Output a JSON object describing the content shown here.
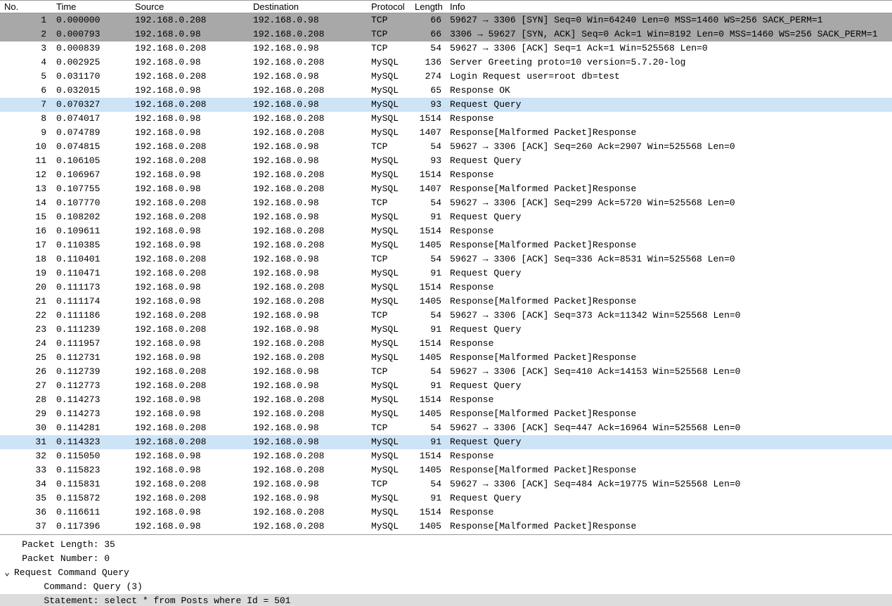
{
  "columns": {
    "no": "No.",
    "time": "Time",
    "src": "Source",
    "dst": "Destination",
    "proto": "Protocol",
    "len": "Length",
    "info": "Info"
  },
  "packets": [
    {
      "no": 1,
      "time": "0.000000",
      "src": "192.168.0.208",
      "dst": "192.168.0.98",
      "proto": "TCP",
      "len": 66,
      "info": "59627 → 3306 [SYN] Seq=0 Win=64240 Len=0 MSS=1460 WS=256 SACK_PERM=1",
      "hl": "sel-dark"
    },
    {
      "no": 2,
      "time": "0.000793",
      "src": "192.168.0.98",
      "dst": "192.168.0.208",
      "proto": "TCP",
      "len": 66,
      "info": "3306 → 59627 [SYN, ACK] Seq=0 Ack=1 Win=8192 Len=0 MSS=1460 WS=256 SACK_PERM=1",
      "hl": "sel-dark"
    },
    {
      "no": 3,
      "time": "0.000839",
      "src": "192.168.0.208",
      "dst": "192.168.0.98",
      "proto": "TCP",
      "len": 54,
      "info": "59627 → 3306 [ACK] Seq=1 Ack=1 Win=525568 Len=0"
    },
    {
      "no": 4,
      "time": "0.002925",
      "src": "192.168.0.98",
      "dst": "192.168.0.208",
      "proto": "MySQL",
      "len": 136,
      "info": "Server Greeting proto=10 version=5.7.20-log"
    },
    {
      "no": 5,
      "time": "0.031170",
      "src": "192.168.0.208",
      "dst": "192.168.0.98",
      "proto": "MySQL",
      "len": 274,
      "info": "Login Request user=root db=test"
    },
    {
      "no": 6,
      "time": "0.032015",
      "src": "192.168.0.98",
      "dst": "192.168.0.208",
      "proto": "MySQL",
      "len": 65,
      "info": "Response OK"
    },
    {
      "no": 7,
      "time": "0.070327",
      "src": "192.168.0.208",
      "dst": "192.168.0.98",
      "proto": "MySQL",
      "len": 93,
      "info": "Request Query",
      "hl": "sel-light"
    },
    {
      "no": 8,
      "time": "0.074017",
      "src": "192.168.0.98",
      "dst": "192.168.0.208",
      "proto": "MySQL",
      "len": 1514,
      "info": "Response"
    },
    {
      "no": 9,
      "time": "0.074789",
      "src": "192.168.0.98",
      "dst": "192.168.0.208",
      "proto": "MySQL",
      "len": 1407,
      "info": "Response[Malformed Packet]Response"
    },
    {
      "no": 10,
      "time": "0.074815",
      "src": "192.168.0.208",
      "dst": "192.168.0.98",
      "proto": "TCP",
      "len": 54,
      "info": "59627 → 3306 [ACK] Seq=260 Ack=2907 Win=525568 Len=0"
    },
    {
      "no": 11,
      "time": "0.106105",
      "src": "192.168.0.208",
      "dst": "192.168.0.98",
      "proto": "MySQL",
      "len": 93,
      "info": "Request Query"
    },
    {
      "no": 12,
      "time": "0.106967",
      "src": "192.168.0.98",
      "dst": "192.168.0.208",
      "proto": "MySQL",
      "len": 1514,
      "info": "Response"
    },
    {
      "no": 13,
      "time": "0.107755",
      "src": "192.168.0.98",
      "dst": "192.168.0.208",
      "proto": "MySQL",
      "len": 1407,
      "info": "Response[Malformed Packet]Response"
    },
    {
      "no": 14,
      "time": "0.107770",
      "src": "192.168.0.208",
      "dst": "192.168.0.98",
      "proto": "TCP",
      "len": 54,
      "info": "59627 → 3306 [ACK] Seq=299 Ack=5720 Win=525568 Len=0"
    },
    {
      "no": 15,
      "time": "0.108202",
      "src": "192.168.0.208",
      "dst": "192.168.0.98",
      "proto": "MySQL",
      "len": 91,
      "info": "Request Query"
    },
    {
      "no": 16,
      "time": "0.109611",
      "src": "192.168.0.98",
      "dst": "192.168.0.208",
      "proto": "MySQL",
      "len": 1514,
      "info": "Response"
    },
    {
      "no": 17,
      "time": "0.110385",
      "src": "192.168.0.98",
      "dst": "192.168.0.208",
      "proto": "MySQL",
      "len": 1405,
      "info": "Response[Malformed Packet]Response"
    },
    {
      "no": 18,
      "time": "0.110401",
      "src": "192.168.0.208",
      "dst": "192.168.0.98",
      "proto": "TCP",
      "len": 54,
      "info": "59627 → 3306 [ACK] Seq=336 Ack=8531 Win=525568 Len=0"
    },
    {
      "no": 19,
      "time": "0.110471",
      "src": "192.168.0.208",
      "dst": "192.168.0.98",
      "proto": "MySQL",
      "len": 91,
      "info": "Request Query"
    },
    {
      "no": 20,
      "time": "0.111173",
      "src": "192.168.0.98",
      "dst": "192.168.0.208",
      "proto": "MySQL",
      "len": 1514,
      "info": "Response"
    },
    {
      "no": 21,
      "time": "0.111174",
      "src": "192.168.0.98",
      "dst": "192.168.0.208",
      "proto": "MySQL",
      "len": 1405,
      "info": "Response[Malformed Packet]Response"
    },
    {
      "no": 22,
      "time": "0.111186",
      "src": "192.168.0.208",
      "dst": "192.168.0.98",
      "proto": "TCP",
      "len": 54,
      "info": "59627 → 3306 [ACK] Seq=373 Ack=11342 Win=525568 Len=0"
    },
    {
      "no": 23,
      "time": "0.111239",
      "src": "192.168.0.208",
      "dst": "192.168.0.98",
      "proto": "MySQL",
      "len": 91,
      "info": "Request Query"
    },
    {
      "no": 24,
      "time": "0.111957",
      "src": "192.168.0.98",
      "dst": "192.168.0.208",
      "proto": "MySQL",
      "len": 1514,
      "info": "Response"
    },
    {
      "no": 25,
      "time": "0.112731",
      "src": "192.168.0.98",
      "dst": "192.168.0.208",
      "proto": "MySQL",
      "len": 1405,
      "info": "Response[Malformed Packet]Response"
    },
    {
      "no": 26,
      "time": "0.112739",
      "src": "192.168.0.208",
      "dst": "192.168.0.98",
      "proto": "TCP",
      "len": 54,
      "info": "59627 → 3306 [ACK] Seq=410 Ack=14153 Win=525568 Len=0"
    },
    {
      "no": 27,
      "time": "0.112773",
      "src": "192.168.0.208",
      "dst": "192.168.0.98",
      "proto": "MySQL",
      "len": 91,
      "info": "Request Query"
    },
    {
      "no": 28,
      "time": "0.114273",
      "src": "192.168.0.98",
      "dst": "192.168.0.208",
      "proto": "MySQL",
      "len": 1514,
      "info": "Response"
    },
    {
      "no": 29,
      "time": "0.114273",
      "src": "192.168.0.98",
      "dst": "192.168.0.208",
      "proto": "MySQL",
      "len": 1405,
      "info": "Response[Malformed Packet]Response"
    },
    {
      "no": 30,
      "time": "0.114281",
      "src": "192.168.0.208",
      "dst": "192.168.0.98",
      "proto": "TCP",
      "len": 54,
      "info": "59627 → 3306 [ACK] Seq=447 Ack=16964 Win=525568 Len=0"
    },
    {
      "no": 31,
      "time": "0.114323",
      "src": "192.168.0.208",
      "dst": "192.168.0.98",
      "proto": "MySQL",
      "len": 91,
      "info": "Request Query",
      "hl": "sel-light"
    },
    {
      "no": 32,
      "time": "0.115050",
      "src": "192.168.0.98",
      "dst": "192.168.0.208",
      "proto": "MySQL",
      "len": 1514,
      "info": "Response"
    },
    {
      "no": 33,
      "time": "0.115823",
      "src": "192.168.0.98",
      "dst": "192.168.0.208",
      "proto": "MySQL",
      "len": 1405,
      "info": "Response[Malformed Packet]Response"
    },
    {
      "no": 34,
      "time": "0.115831",
      "src": "192.168.0.208",
      "dst": "192.168.0.98",
      "proto": "TCP",
      "len": 54,
      "info": "59627 → 3306 [ACK] Seq=484 Ack=19775 Win=525568 Len=0"
    },
    {
      "no": 35,
      "time": "0.115872",
      "src": "192.168.0.208",
      "dst": "192.168.0.98",
      "proto": "MySQL",
      "len": 91,
      "info": "Request Query"
    },
    {
      "no": 36,
      "time": "0.116611",
      "src": "192.168.0.98",
      "dst": "192.168.0.208",
      "proto": "MySQL",
      "len": 1514,
      "info": "Response"
    },
    {
      "no": 37,
      "time": "0.117396",
      "src": "192.168.0.98",
      "dst": "192.168.0.208",
      "proto": "MySQL",
      "len": 1405,
      "info": "Response[Malformed Packet]Response"
    }
  ],
  "details": {
    "pktlen": "Packet Length: 35",
    "pktnum": "Packet Number: 0",
    "reqcmd": "Request Command Query",
    "command": "Command: Query (3)",
    "statement": "Statement: select * from Posts where Id = 501"
  }
}
